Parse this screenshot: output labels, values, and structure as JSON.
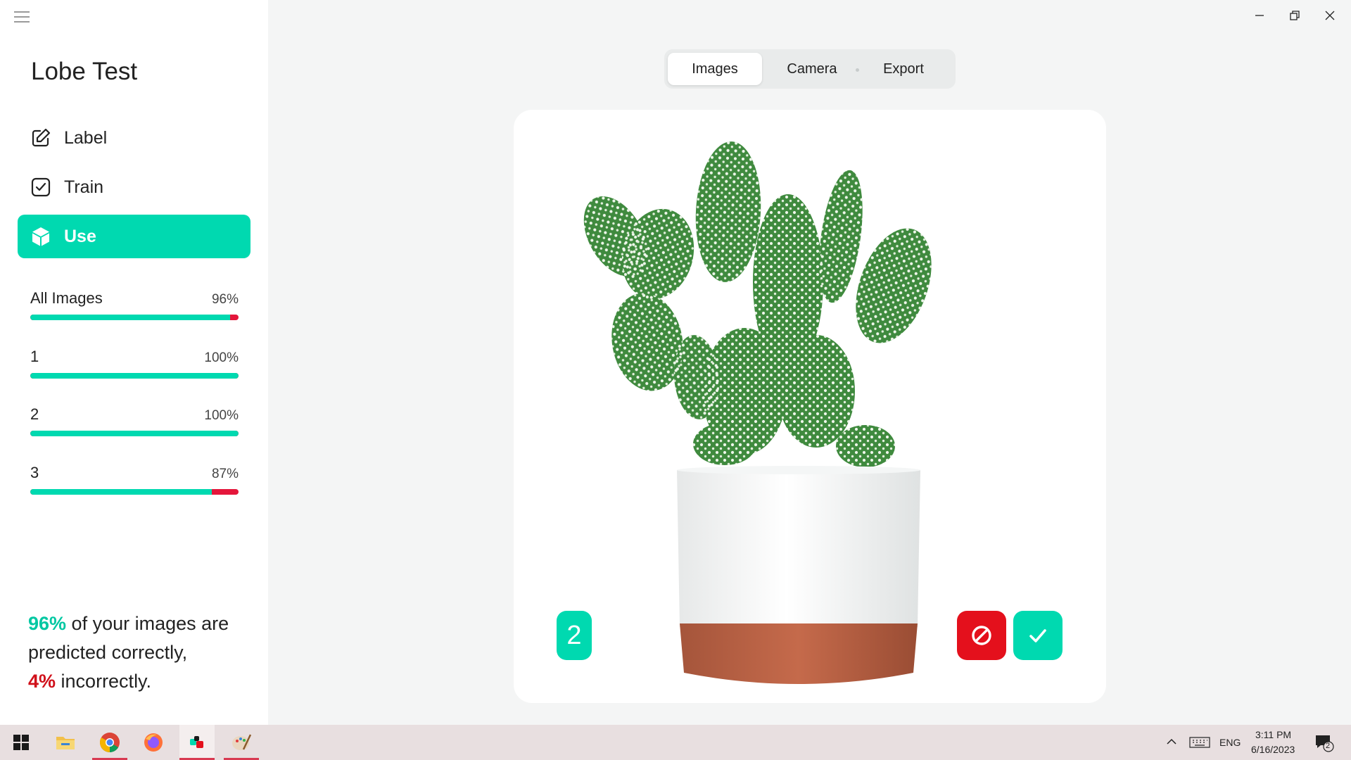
{
  "app": {
    "project_title": "Lobe Test"
  },
  "nav": [
    {
      "label": "Label",
      "icon": "pencil-square-icon",
      "active": false
    },
    {
      "label": "Train",
      "icon": "check-square-icon",
      "active": false
    },
    {
      "label": "Use",
      "icon": "cube-icon",
      "active": true
    }
  ],
  "stats": [
    {
      "label": "All Images",
      "percent_text": "96%",
      "correct": 0.96
    },
    {
      "label": "1",
      "percent_text": "100%",
      "correct": 1.0
    },
    {
      "label": "2",
      "percent_text": "100%",
      "correct": 1.0
    },
    {
      "label": "3",
      "percent_text": "87%",
      "correct": 0.87
    }
  ],
  "summary": {
    "correct_pct": "96%",
    "line1_rest": " of your images are",
    "line2": "predicted correctly,",
    "incorrect_pct": "4%",
    "line3_rest": " incorrectly."
  },
  "tabs": [
    {
      "label": "Images",
      "active": true
    },
    {
      "label": "Camera",
      "active": false
    },
    {
      "label": "Export",
      "active": false
    }
  ],
  "prediction": {
    "label": "2"
  },
  "colors": {
    "accent": "#00d9b0",
    "error": "#e4101c",
    "sidebar_bg": "#ffffff",
    "page_bg": "#f4f5f5"
  },
  "taskbar": {
    "apps": [
      "windows-start-icon",
      "file-explorer-icon",
      "chrome-icon",
      "firefox-icon",
      "lobe-icon",
      "paint-icon"
    ],
    "language": "ENG",
    "time": "3:11 PM",
    "date": "6/16/2023",
    "notification_count": "2"
  }
}
